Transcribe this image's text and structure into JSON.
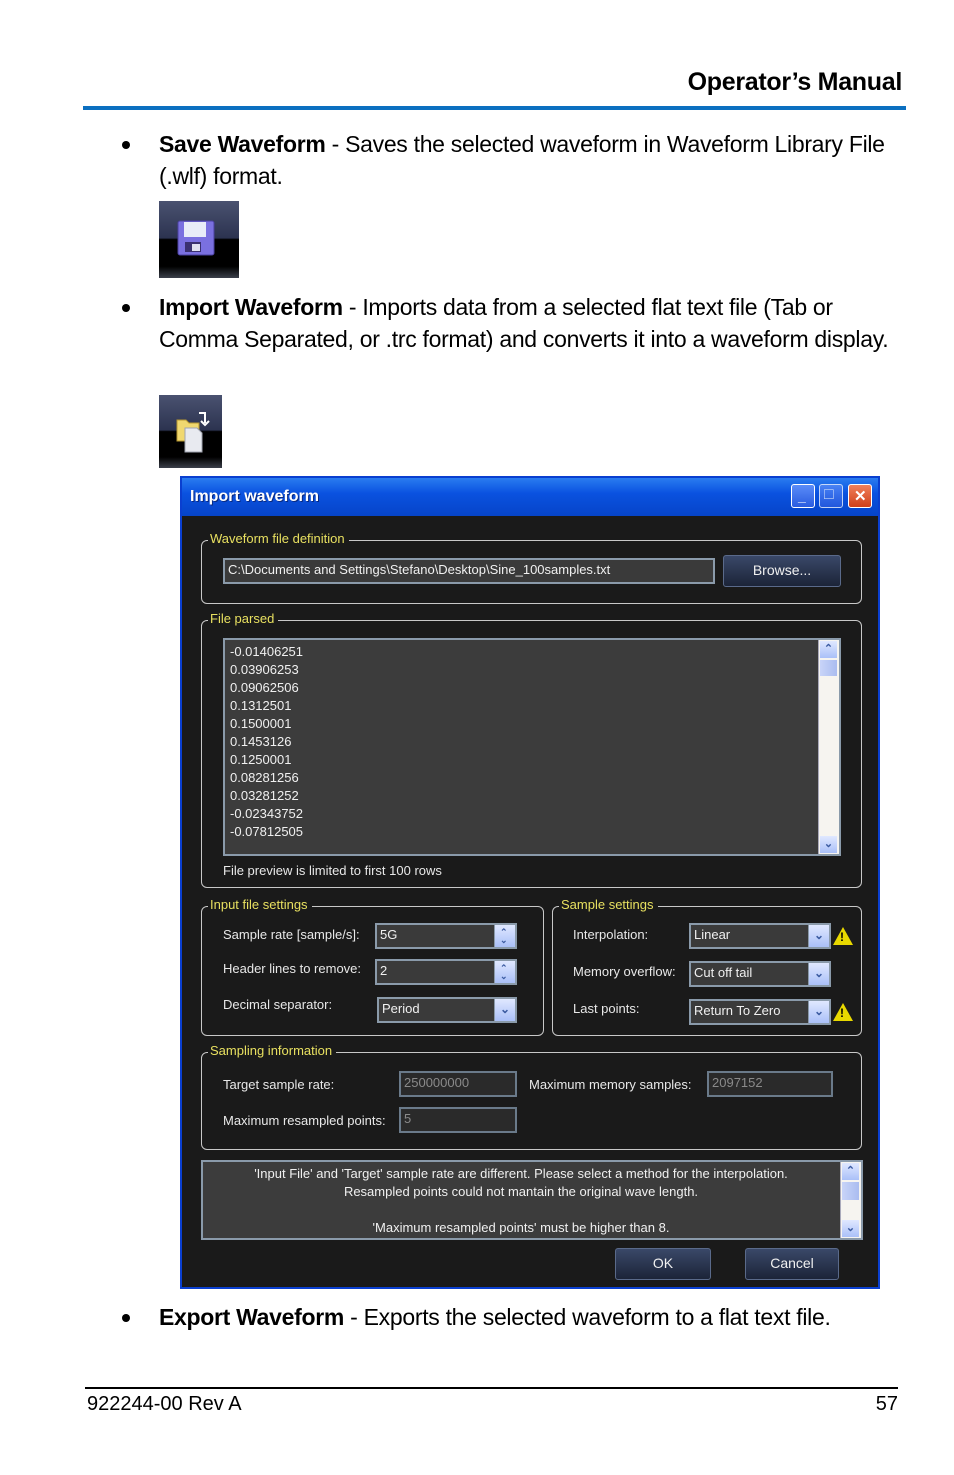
{
  "header": {
    "title": "Operator’s Manual",
    "accent_color": "#0b6fc0"
  },
  "bullets": [
    {
      "term": "Save Waveform",
      "description": " - Saves the selected waveform in Waveform Library File (.wlf) format.",
      "icon": "save-disk-icon"
    },
    {
      "term": "Import Waveform",
      "description": " - Imports data from a selected flat text file (Tab or Comma Separated, or .trc format) and converts it into a waveform display.",
      "icon": "import-folder-icon"
    },
    {
      "term": "Export Waveform",
      "description": " - Exports the selected waveform to a flat text file."
    }
  ],
  "dialog": {
    "title": "Import waveform",
    "window_buttons": {
      "minimize": "_",
      "maximize": "□",
      "close": "✕"
    },
    "file_definition": {
      "legend": "Waveform file definition",
      "path": "C:\\Documents and Settings\\Stefano\\Desktop\\Sine_100samples.txt",
      "browse_label": "Browse..."
    },
    "file_parsed": {
      "legend": "File parsed",
      "rows": [
        "-0.01406251",
        "0.03906253",
        "0.09062506",
        "0.1312501",
        "0.1500001",
        "0.1453126",
        "0.1250001",
        "0.08281256",
        "0.03281252",
        "-0.02343752",
        "-0.07812505"
      ],
      "note": "File preview is limited to first 100 rows"
    },
    "input_file_settings": {
      "legend": "Input file settings",
      "sample_rate_label": "Sample rate [sample/s]:",
      "sample_rate_value": "5G",
      "header_lines_label": "Header lines to remove:",
      "header_lines_value": "2",
      "decimal_sep_label": "Decimal separator:",
      "decimal_sep_value": "Period"
    },
    "sample_settings": {
      "legend": "Sample settings",
      "interpolation_label": "Interpolation:",
      "interpolation_value": "Linear",
      "memory_overflow_label": "Memory overflow:",
      "memory_overflow_value": "Cut off tail",
      "last_points_label": "Last points:",
      "last_points_value": "Return To Zero"
    },
    "sampling_information": {
      "legend": "Sampling information",
      "target_rate_label": "Target sample rate:",
      "target_rate_value": "250000000",
      "max_memory_label": "Maximum memory samples:",
      "max_memory_value": "2097152",
      "max_resampled_label": "Maximum resampled points:",
      "max_resampled_value": "5"
    },
    "messages": [
      "'Input File' and 'Target' sample rate are different. Please select a method for the interpolation.",
      "Resampled points could not mantain the original wave length.",
      "",
      "'Maximum resampled points' must be higher than 8."
    ],
    "ok_label": "OK",
    "cancel_label": "Cancel"
  },
  "footer": {
    "doc_id": "922244-00 Rev A",
    "page": "57"
  }
}
